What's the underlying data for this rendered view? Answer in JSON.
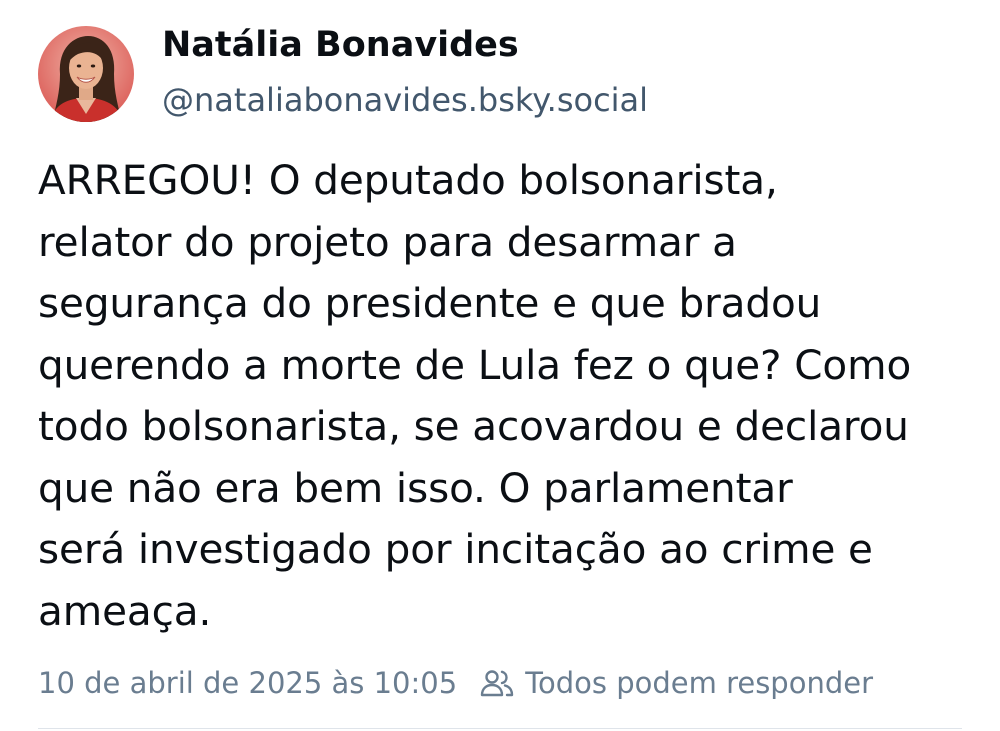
{
  "post": {
    "author": {
      "display_name": "Natália Bonavides",
      "handle": "@nataliabonavides.bsky.social"
    },
    "text": "ARREGOU! O deputado bolsonarista,\nrelator do projeto para desarmar a\nsegurança do presidente e que bradou\nquerendo a morte de Lula fez o que? Como\ntodo bolsonarista, se acovardou e declarou\nque não era bem isso. O parlamentar\nserá investigado por incitação ao crime e\nameaça.",
    "timestamp": "10 de abril de 2025 às 10:05",
    "reply_setting": "Todos podem responder",
    "reply_icon": "people-icon"
  },
  "colors": {
    "text": "#0b0f14",
    "handle": "#42576c",
    "meta": "#6a7d90",
    "avatar_background": "#d9534f"
  }
}
